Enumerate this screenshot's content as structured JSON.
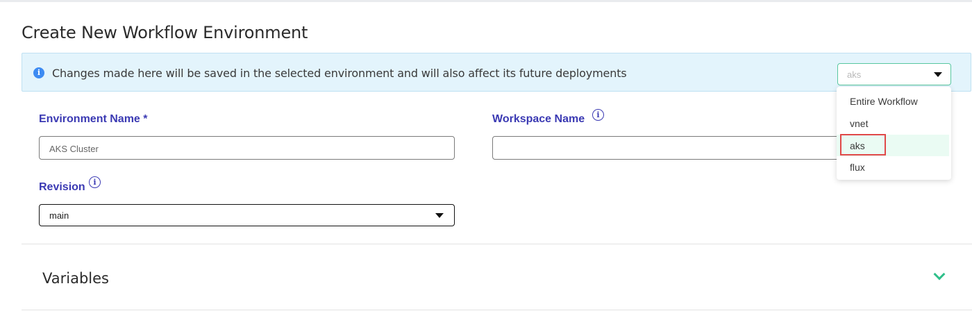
{
  "page": {
    "title": "Create New Workflow Environment"
  },
  "banner": {
    "message": "Changes made here will be saved in the selected environment and will also affect its future deployments",
    "environment_select": {
      "value": "aks",
      "options": [
        "Entire Workflow",
        "vnet",
        "aks",
        "flux"
      ],
      "selected_option": "aks"
    }
  },
  "form": {
    "environment_name": {
      "label": "Environment Name",
      "required_marker": "*",
      "placeholder": "AKS Cluster",
      "value": ""
    },
    "workspace_name": {
      "label": "Workspace Name",
      "value": ""
    },
    "revision": {
      "label": "Revision",
      "value": "main"
    }
  },
  "sections": {
    "variables": {
      "title": "Variables"
    }
  },
  "icons": {
    "info": "info-icon",
    "help": "help-circle-icon",
    "caret": "caret-down-icon",
    "chevron": "chevron-down-icon"
  },
  "colors": {
    "label": "#3b3ab3",
    "banner_bg": "#e3f4fc",
    "accent_green": "#2fbf8a",
    "highlight_red": "#e04848"
  }
}
